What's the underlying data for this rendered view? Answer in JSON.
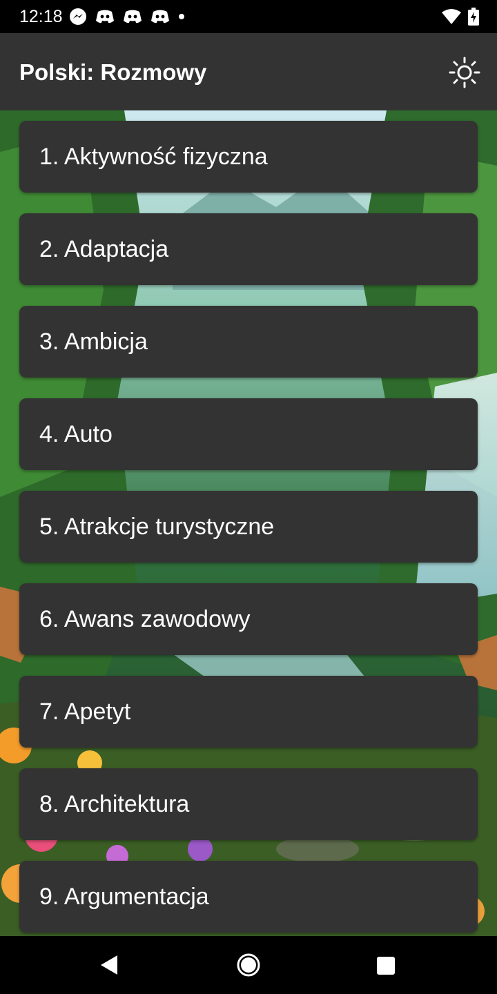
{
  "status_bar": {
    "time": "12:18",
    "left_icons": [
      "messenger-icon",
      "discord-icon",
      "discord-icon",
      "discord-icon",
      "dot-icon"
    ],
    "right_icons": [
      "wifi-icon",
      "battery-charging-icon"
    ]
  },
  "app_bar": {
    "title": "Polski: Rozmowy",
    "theme_icon": "sun-icon"
  },
  "topics": [
    "1. Aktywność fizyczna",
    "2. Adaptacja",
    "3. Ambicja",
    "4. Auto",
    "5. Atrakcje turystyczne",
    "6. Awans zawodowy",
    "7. Apetyt",
    "8. Architektura",
    "9. Argumentacja"
  ],
  "nav_bar": {
    "buttons": [
      "back-icon",
      "home-icon",
      "recents-icon"
    ]
  },
  "colors": {
    "app_bar": "#333333",
    "card": "#333333",
    "text": "#ffffff",
    "status_bar": "#000000"
  }
}
